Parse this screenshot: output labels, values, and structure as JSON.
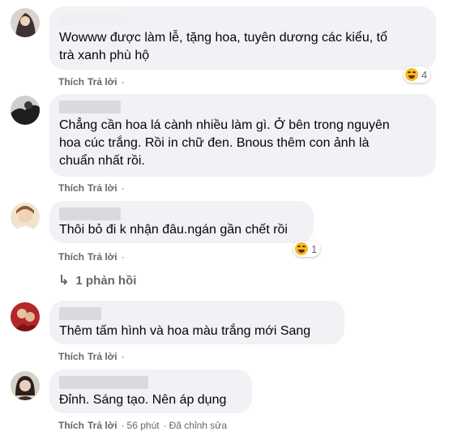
{
  "comments": [
    {
      "text": "Wowww được làm lễ, tặng hoa, tuyên dương các kiểu, tổ\ntrà xanh phù hộ",
      "like": "Thích",
      "reply": "Trả lời",
      "reaction_count": "4",
      "avatar_color": "#3a3030"
    },
    {
      "text": "Chẳng cần hoa lá cành nhiều làm gì. Ở bên trong nguyên\nhoa cúc trắng. Rồi in chữ đen. Bnous thêm con ảnh là\nchuẩn nhất rồi.",
      "like": "Thích",
      "reply": "Trả lời",
      "avatar_color": "#2b2b2b"
    },
    {
      "text": "Thôi bỏ đi k nhận đâu.ngán gần chết rồi",
      "like": "Thích",
      "reply": "Trả lời",
      "reaction_count": "1",
      "avatar_color": "#c8a27a"
    },
    {
      "text": "Thêm tấm hình và hoa màu trắng mới Sang",
      "like": "Thích",
      "reply": "Trả lời",
      "avatar_color": "#b3262a"
    },
    {
      "text": "Đỉnh. Sáng tạo. Nên áp dụng",
      "like": "Thích",
      "reply": "Trả lời",
      "time": "56 phút",
      "edited": "Đã chỉnh sửa",
      "avatar_color": "#3c2f2c"
    }
  ],
  "replies_link": "1 phản hồi",
  "separator": "·",
  "colors": {
    "bubble": "#f0f2f5",
    "meta_text": "#65676b",
    "reaction_emoji": "#f7b928"
  },
  "icons": {
    "reaction": "haha-emoji-icon",
    "reply_arrow": "reply-arrow-icon"
  }
}
